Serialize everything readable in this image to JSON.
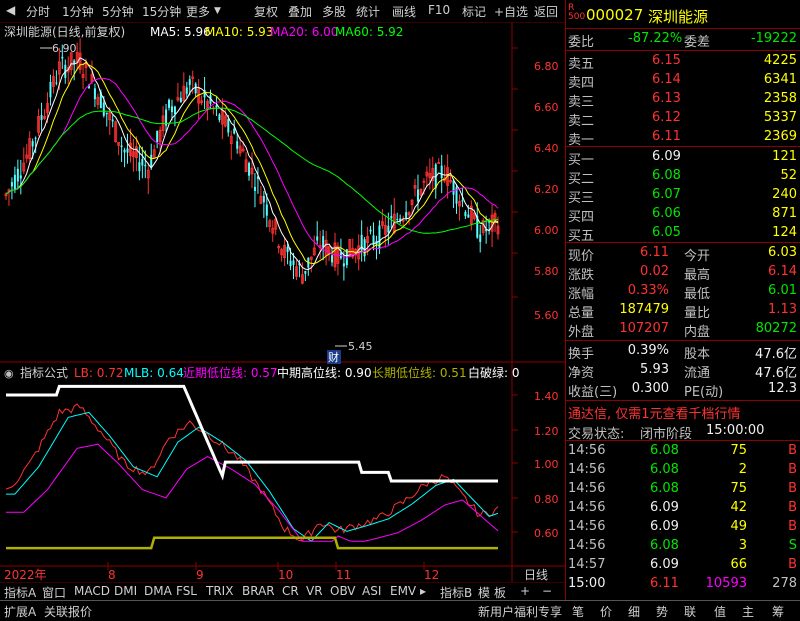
{
  "toolbar": {
    "left": [
      "分时",
      "1分钟",
      "5分钟",
      "15分钟",
      "更多"
    ],
    "right": [
      "复权",
      "叠加",
      "多股",
      "统计",
      "画线",
      "F10",
      "标记",
      "+自选",
      "返回"
    ]
  },
  "chart": {
    "title": "深圳能源(日线,前复权)",
    "ma": [
      {
        "label": "MA5: 5.96",
        "color": "#ffffff"
      },
      {
        "label": "MA10: 5.93",
        "color": "#ffff00"
      },
      {
        "label": "MA20: 6.00",
        "color": "#ff00ff"
      },
      {
        "label": "MA60: 5.92",
        "color": "#00ff00"
      }
    ],
    "y_ticks": [
      "6.80",
      "6.60",
      "6.40",
      "6.20",
      "6.00",
      "5.80",
      "5.60"
    ],
    "high_mark": "6.90",
    "low_mark": "5.45",
    "cai_label": "财"
  },
  "indicator": {
    "name": "指标公式",
    "items": [
      {
        "label": "LB: 0.72",
        "color": "#ff3232"
      },
      {
        "label": "MLB: 0.64",
        "color": "#00ffff"
      },
      {
        "label": "近期低位线: 0.57",
        "color": "#ff00ff"
      },
      {
        "label": "中期高位线: 0.90",
        "color": "#ffffff"
      },
      {
        "label": "长期低位线: 0.51",
        "color": "#b0b000"
      },
      {
        "label": "白破绿: 0",
        "color": "#ffffff"
      }
    ],
    "y_ticks": [
      "1.40",
      "1.20",
      "1.00",
      "0.80",
      "0.60"
    ]
  },
  "x_axis": {
    "labels": [
      "2022年",
      "8",
      "9",
      "10",
      "11",
      "12"
    ],
    "period": "日线"
  },
  "tabs": [
    "指标A",
    "窗口",
    "MACD",
    "DMI",
    "DMA",
    "FSL",
    "TRIX",
    "BRAR",
    "CR",
    "VR",
    "OBV",
    "ASI",
    "EMV",
    "指标B",
    "模",
    "板"
  ],
  "status": {
    "left": [
      "扩展A",
      "关联报价"
    ],
    "promo": "新用户福利专享",
    "right": [
      "笔",
      "价",
      "细",
      "势",
      "联",
      "值",
      "主",
      "筹"
    ]
  },
  "quote": {
    "code": "000027",
    "name": "深圳能源",
    "weibi": {
      "label": "委比",
      "value": "-87.22%",
      "label2": "委差",
      "value2": "-19222"
    },
    "asks": [
      {
        "label": "卖五",
        "price": "6.15",
        "vol": "4225"
      },
      {
        "label": "卖四",
        "price": "6.14",
        "vol": "6341"
      },
      {
        "label": "卖三",
        "price": "6.13",
        "vol": "2358"
      },
      {
        "label": "卖二",
        "price": "6.12",
        "vol": "5337"
      },
      {
        "label": "卖一",
        "price": "6.11",
        "vol": "2369"
      }
    ],
    "bids": [
      {
        "label": "买一",
        "price": "6.09",
        "vol": "121"
      },
      {
        "label": "买二",
        "price": "6.08",
        "vol": "52"
      },
      {
        "label": "买三",
        "price": "6.07",
        "vol": "240"
      },
      {
        "label": "买四",
        "price": "6.06",
        "vol": "871"
      },
      {
        "label": "买五",
        "price": "6.05",
        "vol": "124"
      }
    ],
    "stats": [
      {
        "l1": "现价",
        "v1": "6.11",
        "c1": "red",
        "l2": "今开",
        "v2": "6.03",
        "c2": "yel"
      },
      {
        "l1": "涨跌",
        "v1": "0.02",
        "c1": "red",
        "l2": "最高",
        "v2": "6.14",
        "c2": "red"
      },
      {
        "l1": "涨幅",
        "v1": "0.33%",
        "c1": "red",
        "l2": "最低",
        "v2": "6.01",
        "c2": "grn"
      },
      {
        "l1": "总量",
        "v1": "187479",
        "c1": "yel",
        "l2": "量比",
        "v2": "1.13",
        "c2": "red"
      },
      {
        "l1": "外盘",
        "v1": "107207",
        "c1": "red",
        "l2": "内盘",
        "v2": "80272",
        "c2": "grn"
      }
    ],
    "stats2": [
      {
        "l1": "换手",
        "v1": "0.39%",
        "l2": "股本",
        "v2": "47.6亿"
      },
      {
        "l1": "净资",
        "v1": "5.93",
        "l2": "流通",
        "v2": "47.6亿"
      },
      {
        "l1": "收益(三)",
        "v1": "0.300",
        "l2": "PE(动)",
        "v2": "12.3"
      }
    ],
    "ad": "通达信, 仅需1元查看千档行情",
    "trade_state_label": "交易状态:",
    "trade_state": "闭市阶段",
    "trade_time": "15:00:00",
    "ticks": [
      {
        "time": "14:56",
        "price": "6.08",
        "pc": "grn",
        "vol": "75",
        "side": "B",
        "sc": "red"
      },
      {
        "time": "14:56",
        "price": "6.08",
        "pc": "grn",
        "vol": "2",
        "side": "B",
        "sc": "red"
      },
      {
        "time": "14:56",
        "price": "6.08",
        "pc": "grn",
        "vol": "75",
        "side": "B",
        "sc": "red"
      },
      {
        "time": "14:56",
        "price": "6.09",
        "pc": "wht",
        "vol": "42",
        "side": "B",
        "sc": "red"
      },
      {
        "time": "14:56",
        "price": "6.09",
        "pc": "wht",
        "vol": "49",
        "side": "B",
        "sc": "red"
      },
      {
        "time": "14:56",
        "price": "6.08",
        "pc": "grn",
        "vol": "3",
        "side": "S",
        "sc": "grn"
      },
      {
        "time": "14:57",
        "price": "6.09",
        "pc": "wht",
        "vol": "66",
        "side": "B",
        "sc": "red"
      },
      {
        "time": "15:00",
        "price": "6.11",
        "pc": "red",
        "vol": "10593",
        "side": "278",
        "sc": "gry"
      }
    ]
  }
}
